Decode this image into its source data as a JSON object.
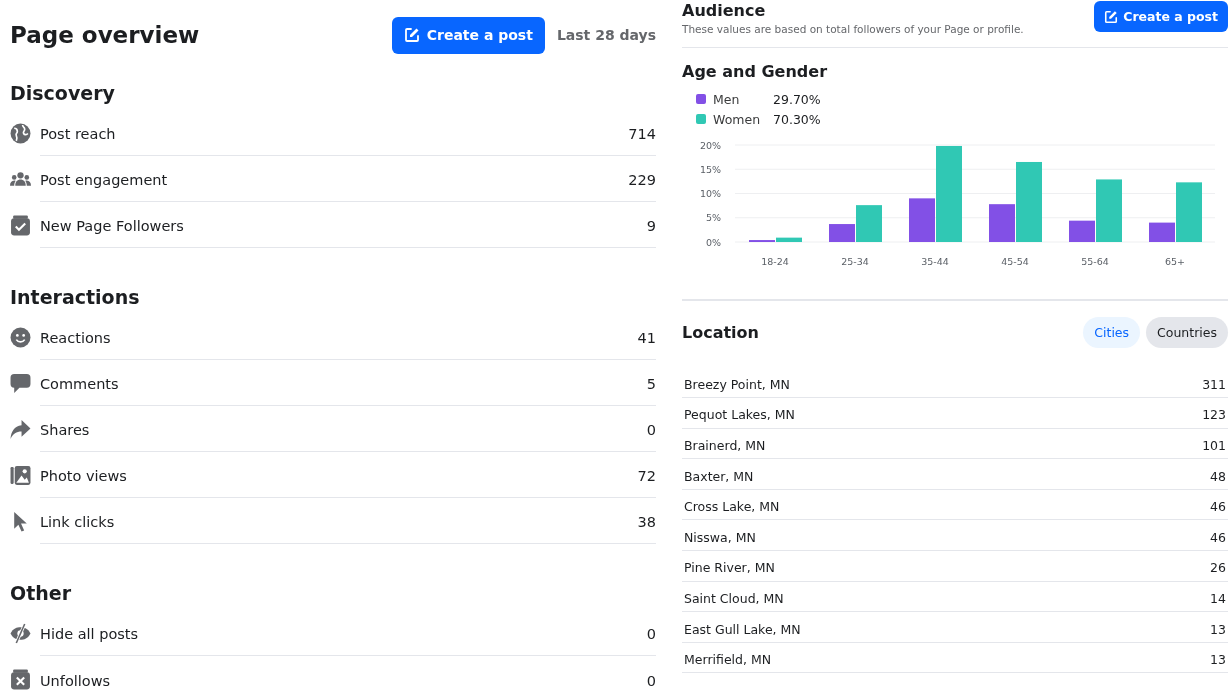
{
  "overview": {
    "title": "Page overview",
    "create_button": "Create a post",
    "period": "Last 28 days",
    "sections": [
      {
        "heading": "Discovery",
        "metrics": [
          {
            "kind": "globe",
            "label": "Post reach",
            "value": "714"
          },
          {
            "kind": "people",
            "label": "Post engagement",
            "value": "229"
          },
          {
            "kind": "follow",
            "label": "New Page Followers",
            "value": "9"
          }
        ]
      },
      {
        "heading": "Interactions",
        "metrics": [
          {
            "kind": "smile",
            "label": "Reactions",
            "value": "41"
          },
          {
            "kind": "comment",
            "label": "Comments",
            "value": "5"
          },
          {
            "kind": "share",
            "label": "Shares",
            "value": "0"
          },
          {
            "kind": "photo",
            "label": "Photo views",
            "value": "72"
          },
          {
            "kind": "cursor",
            "label": "Link clicks",
            "value": "38"
          }
        ]
      },
      {
        "heading": "Other",
        "metrics": [
          {
            "kind": "hide",
            "label": "Hide all posts",
            "value": "0"
          },
          {
            "kind": "unfollow",
            "label": "Unfollows",
            "value": "0"
          }
        ]
      }
    ]
  },
  "audience": {
    "title": "Audience",
    "subtitle": "These values are based on total followers of your Page or profile.",
    "create_button": "Create a post",
    "age_gender": {
      "heading": "Age and Gender",
      "legend": [
        {
          "value": "29.70%"
        },
        {
          "value": "70.30%"
        }
      ],
      "chart_data": {
        "type": "bar",
        "categories": [
          "18-24",
          "25-34",
          "35-44",
          "45-54",
          "55-64",
          "65+"
        ],
        "series": [
          {
            "name": "Men",
            "color": "#8250e6",
            "values": [
              0.4,
              3.7,
              9.0,
              7.8,
              4.4,
              4.0
            ]
          },
          {
            "name": "Women",
            "color": "#30c8b4",
            "values": [
              0.9,
              7.6,
              19.8,
              16.5,
              12.9,
              12.3
            ]
          }
        ],
        "ylim": [
          0,
          20
        ],
        "grid": true,
        "yticks": [
          {
            "value": 0,
            "label": "0%"
          },
          {
            "value": 5,
            "label": "5%"
          },
          {
            "value": 10,
            "label": "10%"
          },
          {
            "value": 15,
            "label": "15%"
          },
          {
            "value": 20,
            "label": "20%"
          }
        ]
      }
    },
    "location": {
      "heading": "Location",
      "tabs": [
        {
          "label": "Cities",
          "selected": true
        },
        {
          "label": "Countries",
          "selected": false
        }
      ],
      "rows": [
        {
          "name": "Breezy Point, MN",
          "value": "311"
        },
        {
          "name": "Pequot Lakes, MN",
          "value": "123"
        },
        {
          "name": "Brainerd, MN",
          "value": "101"
        },
        {
          "name": "Baxter, MN",
          "value": "48"
        },
        {
          "name": "Cross Lake, MN",
          "value": "46"
        },
        {
          "name": "Nisswa, MN",
          "value": "46"
        },
        {
          "name": "Pine River, MN",
          "value": "26"
        },
        {
          "name": "Saint Cloud, MN",
          "value": "14"
        },
        {
          "name": "East Gull Lake, MN",
          "value": "13"
        },
        {
          "name": "Merrifield, MN",
          "value": "13"
        }
      ]
    }
  }
}
